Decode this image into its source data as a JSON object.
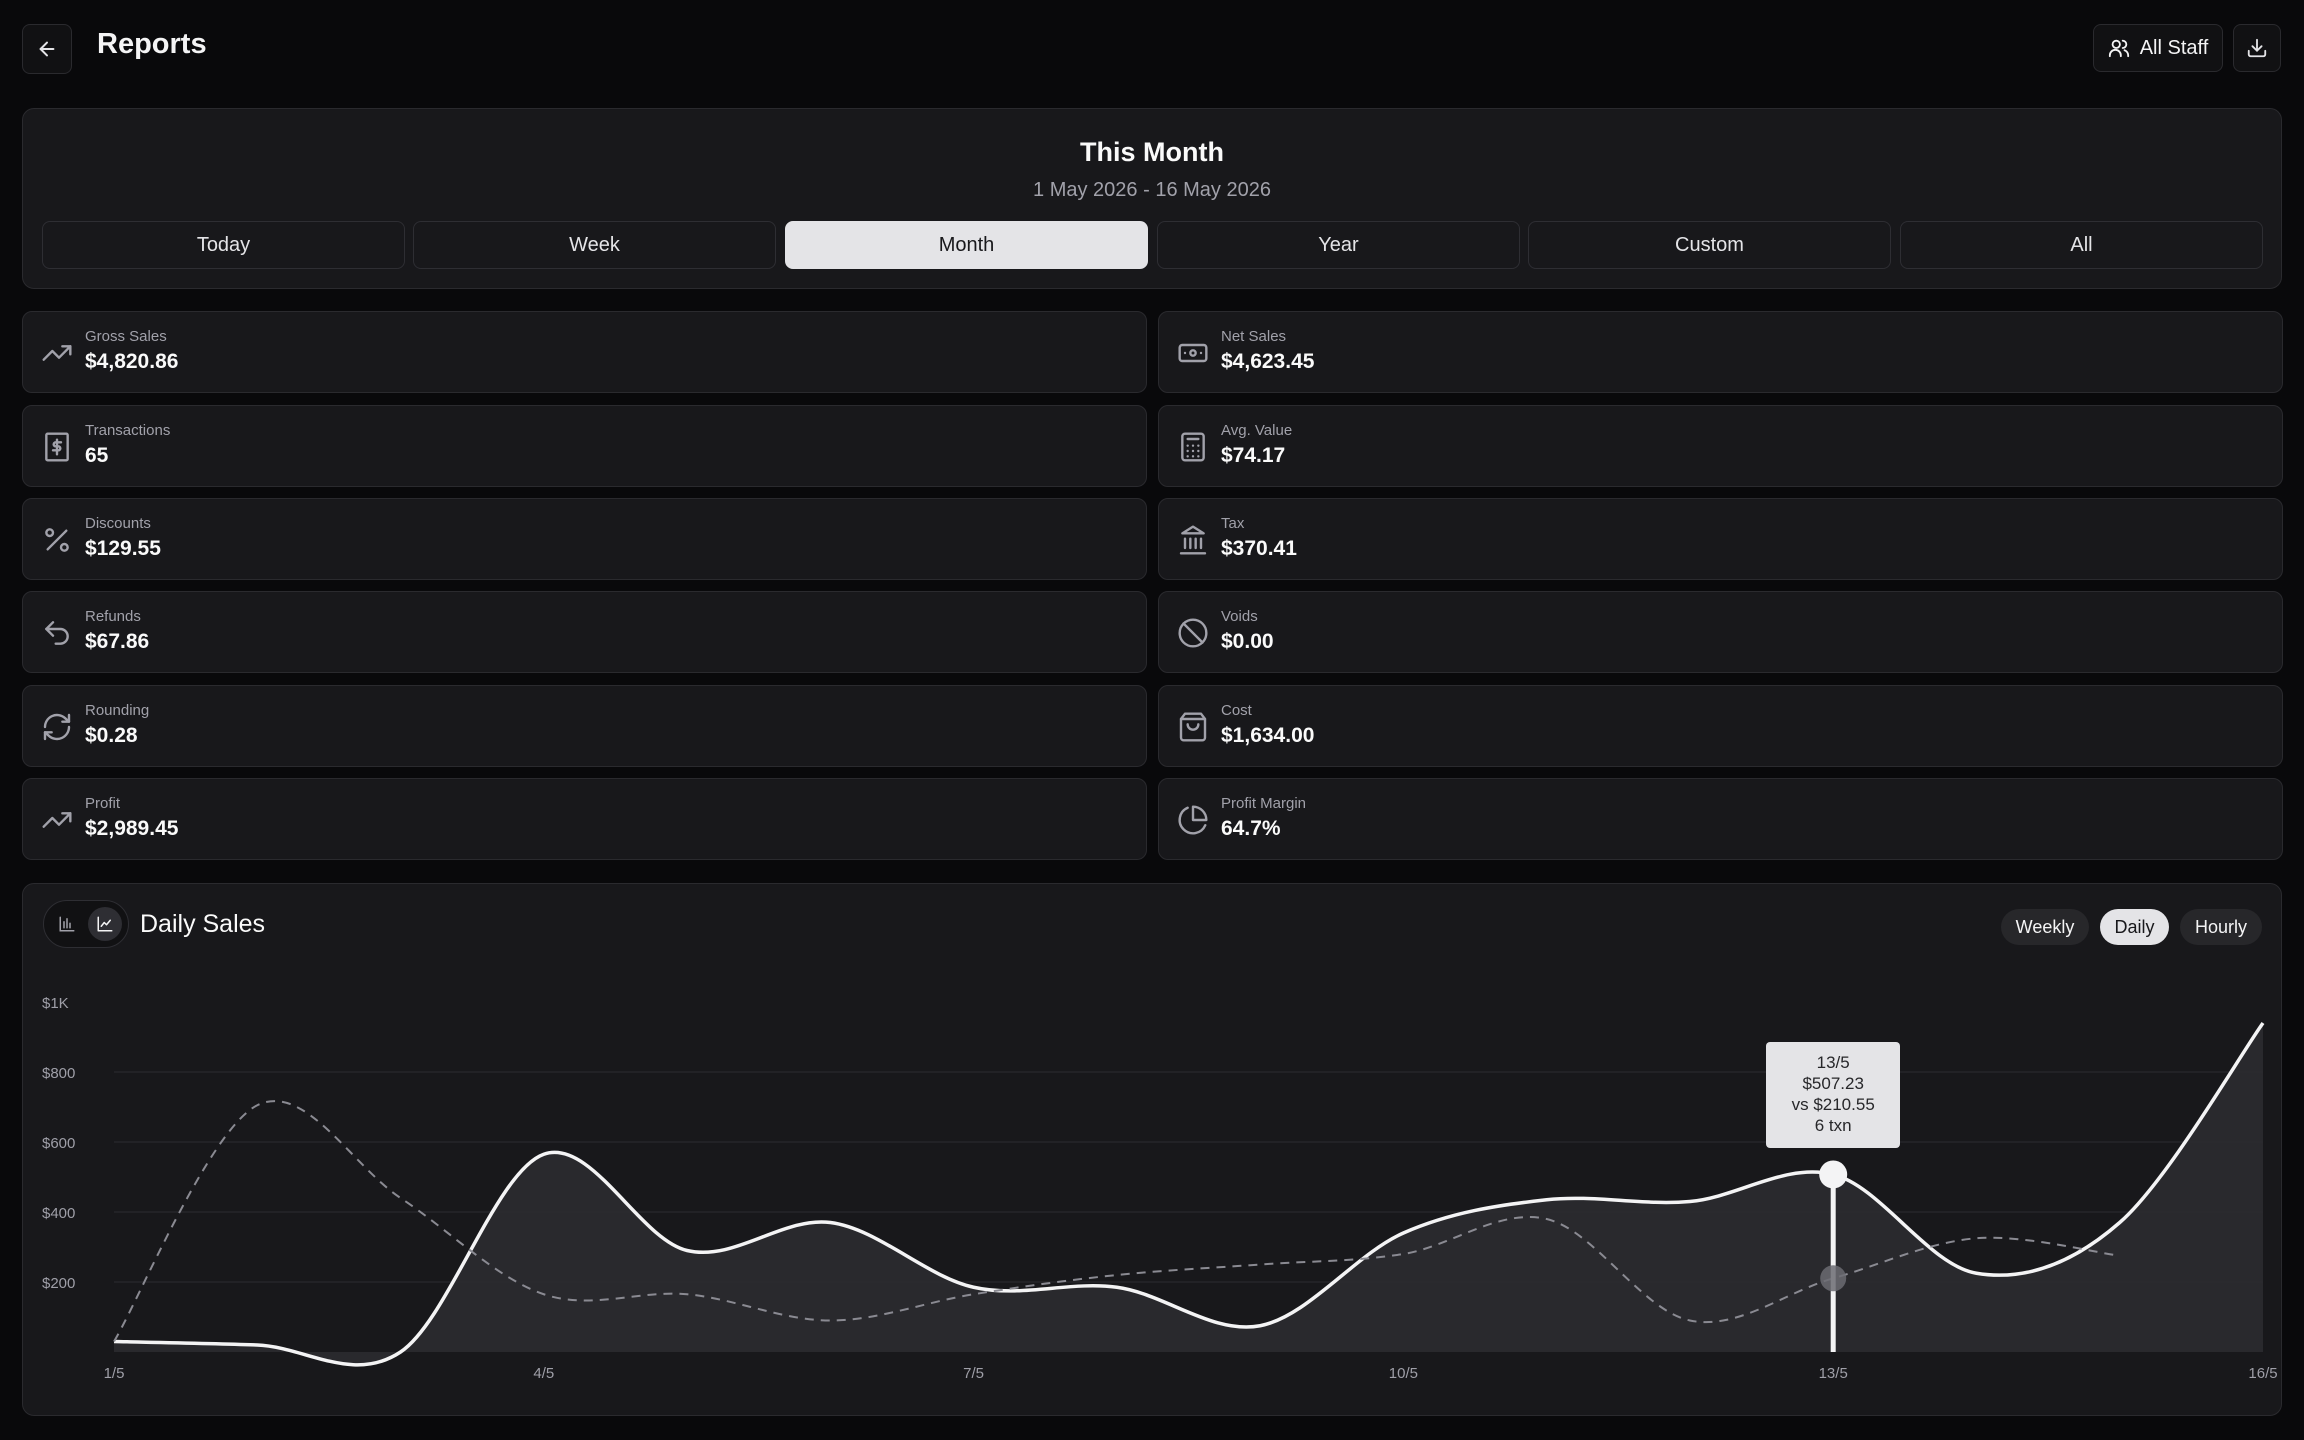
{
  "header": {
    "title": "Reports",
    "back_icon": "arrow-left-icon",
    "staff_filter_label": "All Staff",
    "staff_icon": "users-icon",
    "download_icon": "download-icon"
  },
  "period": {
    "title": "This Month",
    "range": "1 May 2026 - 16 May 2026",
    "tabs": [
      {
        "label": "Today",
        "active": false
      },
      {
        "label": "Week",
        "active": false
      },
      {
        "label": "Month",
        "active": true
      },
      {
        "label": "Year",
        "active": false
      },
      {
        "label": "Custom",
        "active": false
      },
      {
        "label": "All",
        "active": false
      }
    ]
  },
  "stats": [
    {
      "label": "Gross Sales",
      "value": "$4,820.86",
      "icon": "trending-up-icon"
    },
    {
      "label": "Net Sales",
      "value": "$4,623.45",
      "icon": "banknote-icon"
    },
    {
      "label": "Transactions",
      "value": "65",
      "icon": "receipt-icon"
    },
    {
      "label": "Avg. Value",
      "value": "$74.17",
      "icon": "calculator-icon"
    },
    {
      "label": "Discounts",
      "value": "$129.55",
      "icon": "percent-icon"
    },
    {
      "label": "Tax",
      "value": "$370.41",
      "icon": "landmark-icon"
    },
    {
      "label": "Refunds",
      "value": "$67.86",
      "icon": "undo-icon"
    },
    {
      "label": "Voids",
      "value": "$0.00",
      "icon": "ban-icon"
    },
    {
      "label": "Rounding",
      "value": "$0.28",
      "icon": "refresh-icon"
    },
    {
      "label": "Cost",
      "value": "$1,634.00",
      "icon": "shopping-bag-icon"
    },
    {
      "label": "Profit",
      "value": "$2,989.45",
      "icon": "trending-up-icon"
    },
    {
      "label": "Profit Margin",
      "value": "64.7%",
      "icon": "pie-chart-icon"
    }
  ],
  "chart_section": {
    "title": "Daily Sales",
    "view_toggle": [
      "bar-chart-icon",
      "line-chart-icon"
    ],
    "active_view": "line-chart-icon",
    "granularity": [
      {
        "label": "Weekly",
        "active": false
      },
      {
        "label": "Daily",
        "active": true
      },
      {
        "label": "Hourly",
        "active": false
      }
    ],
    "tooltip": {
      "date": "13/5",
      "value": "$507.23",
      "compare": "vs $210.55",
      "txn": "6 txn"
    }
  },
  "chart_data": {
    "type": "area",
    "ylim": [
      0,
      1000
    ],
    "y_ticks": [
      {
        "value": 200,
        "label": "$200"
      },
      {
        "value": 400,
        "label": "$400"
      },
      {
        "value": 600,
        "label": "$600"
      },
      {
        "value": 800,
        "label": "$800"
      },
      {
        "value": 1000,
        "label": "$1K"
      }
    ],
    "x_ticks": [
      {
        "day": 1,
        "label": "1/5"
      },
      {
        "day": 4,
        "label": "4/5"
      },
      {
        "day": 7,
        "label": "7/5"
      },
      {
        "day": 10,
        "label": "10/5"
      },
      {
        "day": 13,
        "label": "13/5"
      },
      {
        "day": 16,
        "label": "16/5"
      }
    ],
    "series": [
      {
        "style": "solid",
        "points": [
          [
            1,
            30
          ],
          [
            2,
            20
          ],
          [
            3,
            0
          ],
          [
            4,
            565
          ],
          [
            5,
            290
          ],
          [
            6,
            370
          ],
          [
            7,
            185
          ],
          [
            8,
            185
          ],
          [
            9,
            75
          ],
          [
            10,
            340
          ],
          [
            11,
            435
          ],
          [
            12,
            430
          ],
          [
            13,
            507.23
          ],
          [
            14,
            225
          ],
          [
            15,
            370
          ],
          [
            16,
            940
          ]
        ]
      },
      {
        "style": "dashed",
        "points": [
          [
            1,
            30
          ],
          [
            2,
            705
          ],
          [
            3,
            440
          ],
          [
            4,
            165
          ],
          [
            5,
            165
          ],
          [
            6,
            90
          ],
          [
            7,
            165
          ],
          [
            8,
            220
          ],
          [
            9,
            250
          ],
          [
            10,
            280
          ],
          [
            11,
            380
          ],
          [
            12,
            90
          ],
          [
            13,
            210.55
          ],
          [
            14,
            325
          ],
          [
            15,
            275
          ]
        ]
      }
    ],
    "highlight_day": 13,
    "grid": true
  }
}
